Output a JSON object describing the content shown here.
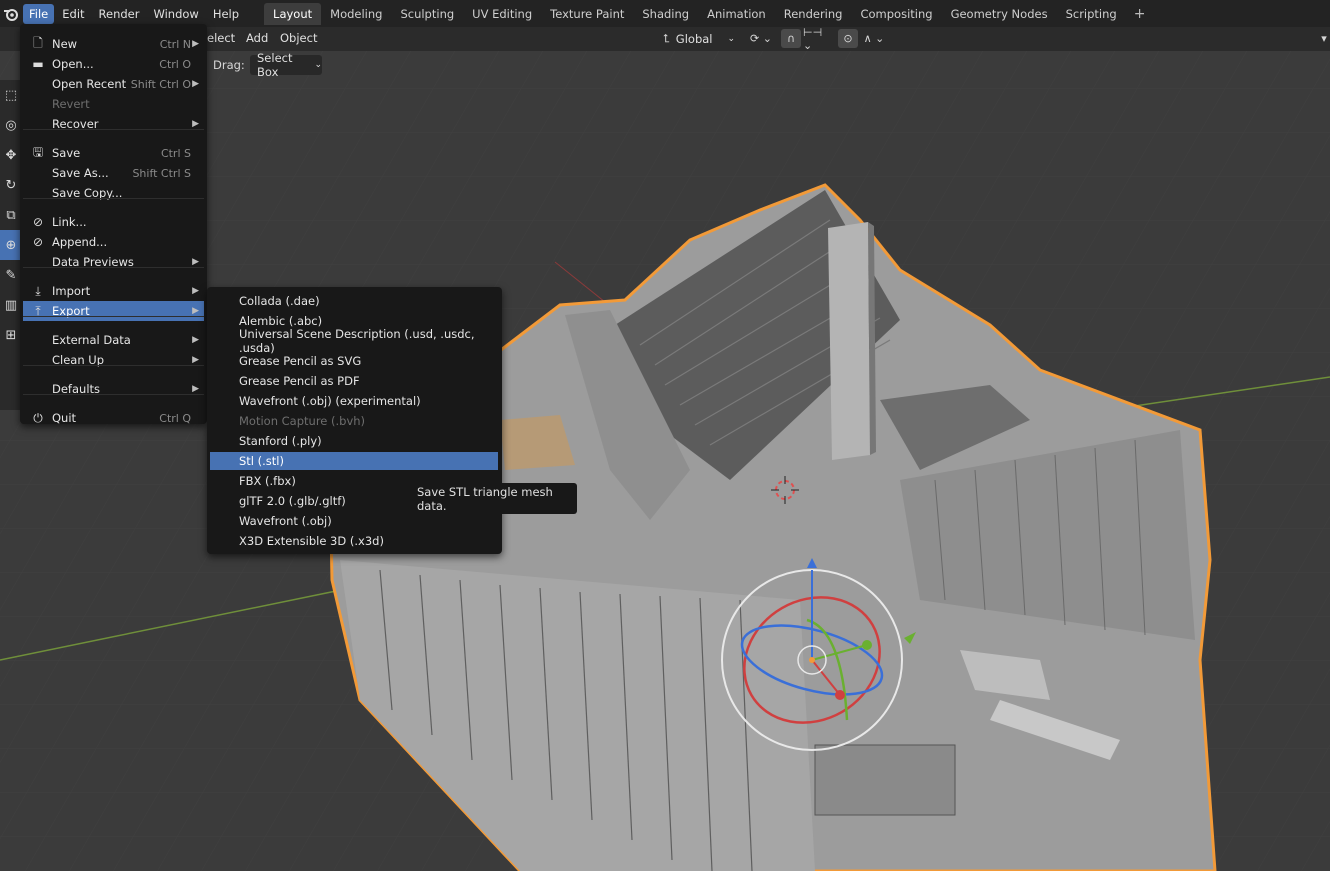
{
  "topbar": {
    "menus": [
      "File",
      "Edit",
      "Render",
      "Window",
      "Help"
    ],
    "active_menu": "File",
    "workspaces": [
      "Layout",
      "Modeling",
      "Sculpting",
      "UV Editing",
      "Texture Paint",
      "Shading",
      "Animation",
      "Rendering",
      "Compositing",
      "Geometry Nodes",
      "Scripting"
    ],
    "active_workspace": "Layout",
    "add_tab": "+"
  },
  "viewport_header": {
    "select_partial": "elect",
    "add": "Add",
    "object": "Object",
    "transform_orientation": "Global",
    "drag_label": "Drag:",
    "drag_value": "Select Box"
  },
  "file_menu": {
    "items": [
      {
        "label": "New",
        "shortcut": "Ctrl N",
        "icon": "new-file-icon",
        "submenu": true
      },
      {
        "label": "Open...",
        "shortcut": "Ctrl O",
        "icon": "folder-icon"
      },
      {
        "label": "Open Recent",
        "shortcut": "Shift Ctrl O",
        "submenu": true
      },
      {
        "label": "Revert",
        "disabled": true
      },
      {
        "label": "Recover",
        "submenu": true
      },
      {
        "label": "Save",
        "shortcut": "Ctrl S",
        "icon": "save-icon"
      },
      {
        "label": "Save As...",
        "shortcut": "Shift Ctrl S"
      },
      {
        "label": "Save Copy..."
      },
      {
        "label": "Link...",
        "icon": "link-icon"
      },
      {
        "label": "Append...",
        "icon": "append-icon"
      },
      {
        "label": "Data Previews",
        "submenu": true
      },
      {
        "label": "Import",
        "icon": "import-icon",
        "submenu": true
      },
      {
        "label": "Export",
        "icon": "export-icon",
        "submenu": true,
        "highlight": true
      },
      {
        "label": "External Data",
        "submenu": true
      },
      {
        "label": "Clean Up",
        "submenu": true
      },
      {
        "label": "Defaults",
        "submenu": true
      },
      {
        "label": "Quit",
        "shortcut": "Ctrl Q",
        "icon": "quit-icon"
      }
    ]
  },
  "export_menu": {
    "items": [
      {
        "label": "Collada (.dae)"
      },
      {
        "label": "Alembic (.abc)"
      },
      {
        "label": "Universal Scene Description (.usd, .usdc, .usda)"
      },
      {
        "label": "Grease Pencil as SVG"
      },
      {
        "label": "Grease Pencil as PDF"
      },
      {
        "label": "Wavefront (.obj) (experimental)"
      },
      {
        "label": "Motion Capture (.bvh)",
        "disabled": true
      },
      {
        "label": "Stanford (.ply)"
      },
      {
        "label": "Stl (.stl)",
        "highlight": true
      },
      {
        "label": "FBX (.fbx)"
      },
      {
        "label": "glTF 2.0 (.glb/.gltf)"
      },
      {
        "label": "Wavefront (.obj)"
      },
      {
        "label": "X3D Extensible 3D (.x3d)"
      }
    ]
  },
  "tooltip": {
    "text": "Save STL triangle mesh data."
  },
  "colors": {
    "accent": "#4772b3",
    "menu_bg": "#181818",
    "viewport_bg": "#3a3a3a",
    "selection_outline": "#f29a38",
    "mesh": "#9a9a9a"
  }
}
